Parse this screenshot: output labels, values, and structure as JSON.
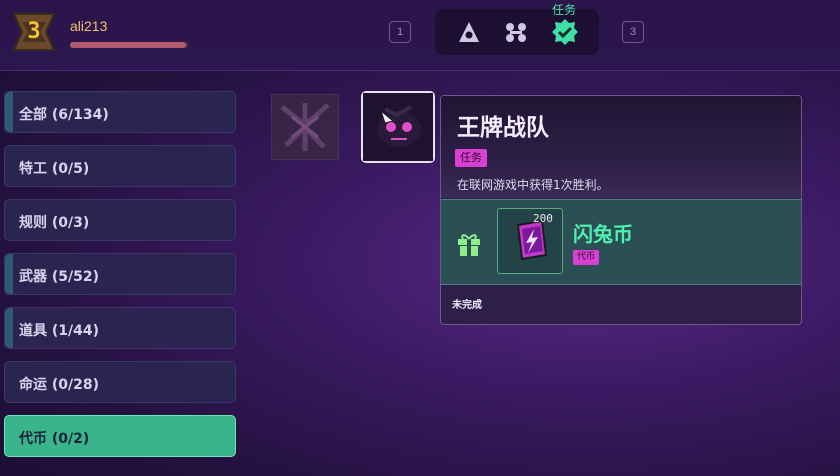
{
  "player": {
    "level": "3",
    "username": "ali213",
    "xp_fraction": 0.98
  },
  "tabs": {
    "left_key": "1",
    "right_key": "3",
    "active_label": "任务",
    "items": [
      {
        "icon": "eye-triangle-icon",
        "active": false
      },
      {
        "icon": "nodes-icon",
        "active": false
      },
      {
        "icon": "check-badge-icon",
        "active": true
      }
    ]
  },
  "sidebar": {
    "items": [
      {
        "label": "全部 (6/134)",
        "active": false,
        "marker": true
      },
      {
        "label": "特工 (0/5)",
        "active": false,
        "marker": false
      },
      {
        "label": "规则 (0/3)",
        "active": false,
        "marker": false
      },
      {
        "label": "武器 (5/52)",
        "active": false,
        "marker": true
      },
      {
        "label": "道具 (1/44)",
        "active": false,
        "marker": true
      },
      {
        "label": "命运 (0/28)",
        "active": false,
        "marker": false
      },
      {
        "label": "代币 (0/2)",
        "active": true,
        "marker": false
      }
    ]
  },
  "tooltip": {
    "title": "王牌战队",
    "tag": "任务",
    "description": "在联网游戏中获得1次胜利。",
    "reward": {
      "count": "200",
      "name": "闪兔币",
      "tag": "代币",
      "icon": "lightning-coin-icon"
    },
    "status": "未完成"
  },
  "colors": {
    "accent": "#3ab48a",
    "highlight": "#4ff0b0",
    "tag": "#d93fd0",
    "level": "#f2c12e"
  }
}
